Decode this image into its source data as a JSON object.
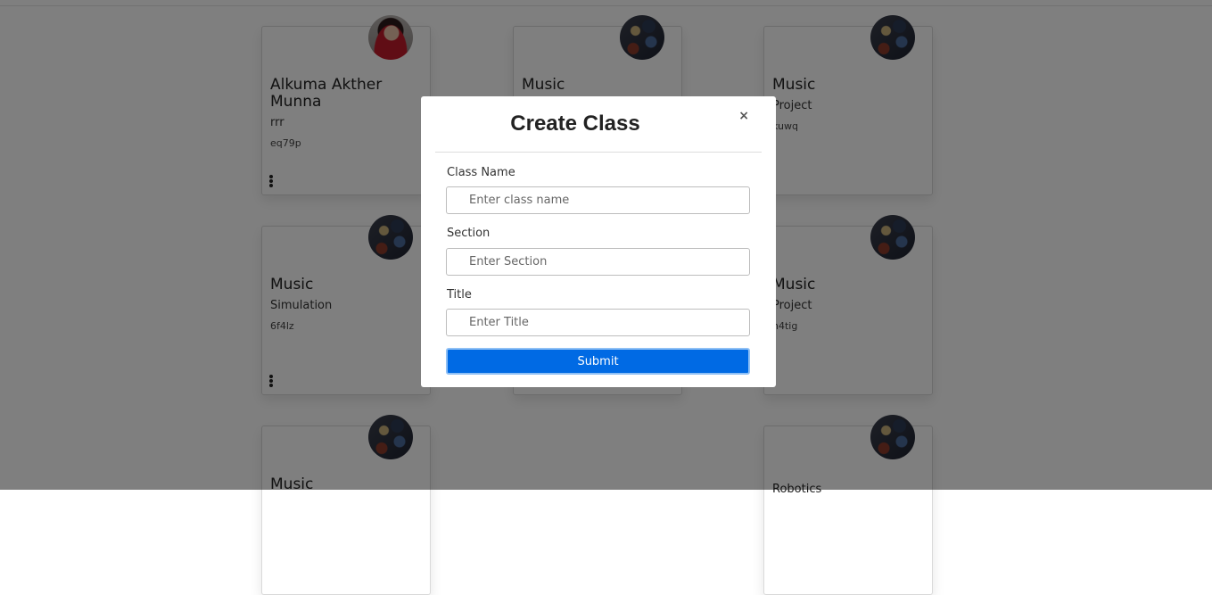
{
  "cards": [
    {
      "title": "Alkuma Akther Munna",
      "section": "rrr",
      "code": "eq79p",
      "menu": true,
      "avatar": "person-photo"
    },
    {
      "title": "Music",
      "section": "",
      "code": "",
      "menu": false,
      "avatar": "class-photo"
    },
    {
      "title": "Music",
      "section": "Project",
      "code": "kuwq",
      "menu": false,
      "avatar": "class-photo"
    },
    {
      "title": "Music",
      "section": "Simulation",
      "code": "6f4lz",
      "menu": true,
      "avatar": "class-photo"
    },
    {
      "title": "",
      "section": "",
      "code": "",
      "menu": false,
      "avatar": "class-photo"
    },
    {
      "title": "Music",
      "section": "Project",
      "code": "n4tig",
      "menu": false,
      "avatar": "class-photo"
    },
    {
      "title": "Music",
      "section": "",
      "code": "",
      "menu": false,
      "avatar": "class-photo"
    },
    {
      "title": "Robotics",
      "section": "",
      "code": "",
      "menu": false,
      "avatar": "class-photo"
    }
  ],
  "modal": {
    "title": "Create Class",
    "close_label": "×",
    "fields": [
      {
        "label": "Class Name",
        "placeholder": "Enter class name",
        "value": ""
      },
      {
        "label": "Section",
        "placeholder": "Enter Section",
        "value": ""
      },
      {
        "label": "Title",
        "placeholder": "Enter Title",
        "value": ""
      }
    ],
    "submit_label": "Submit"
  }
}
